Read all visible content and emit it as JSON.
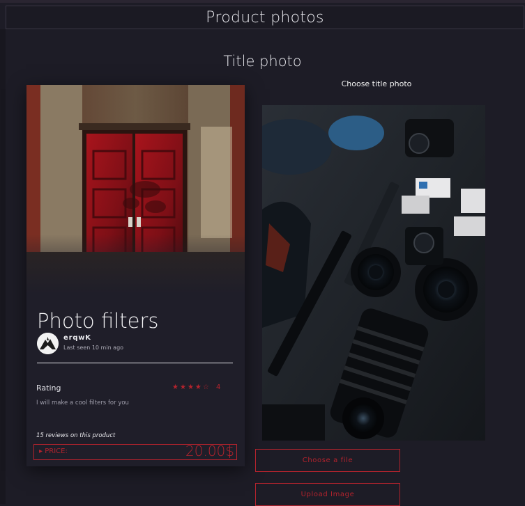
{
  "header": {
    "title": "Product photos"
  },
  "section": {
    "title": "Title photo",
    "choose_label": "Choose title photo"
  },
  "card": {
    "title": "Photo filters",
    "username": "erqwK",
    "last_seen": "Last seen 10 min ago",
    "rating_label": "Rating",
    "rating_value": "4",
    "rating_stars": 4,
    "rating_max": 5,
    "description": "I will make a cool filters for you",
    "reviews": "15 reviews on this product",
    "price_label": "PRICE:",
    "price_value": "20.00$"
  },
  "buttons": {
    "choose_file": "Choose a file",
    "upload_image": "Upload Image"
  },
  "colors": {
    "background": "#1d1c26",
    "accent": "#b3232d",
    "card": "#1f1e29"
  }
}
